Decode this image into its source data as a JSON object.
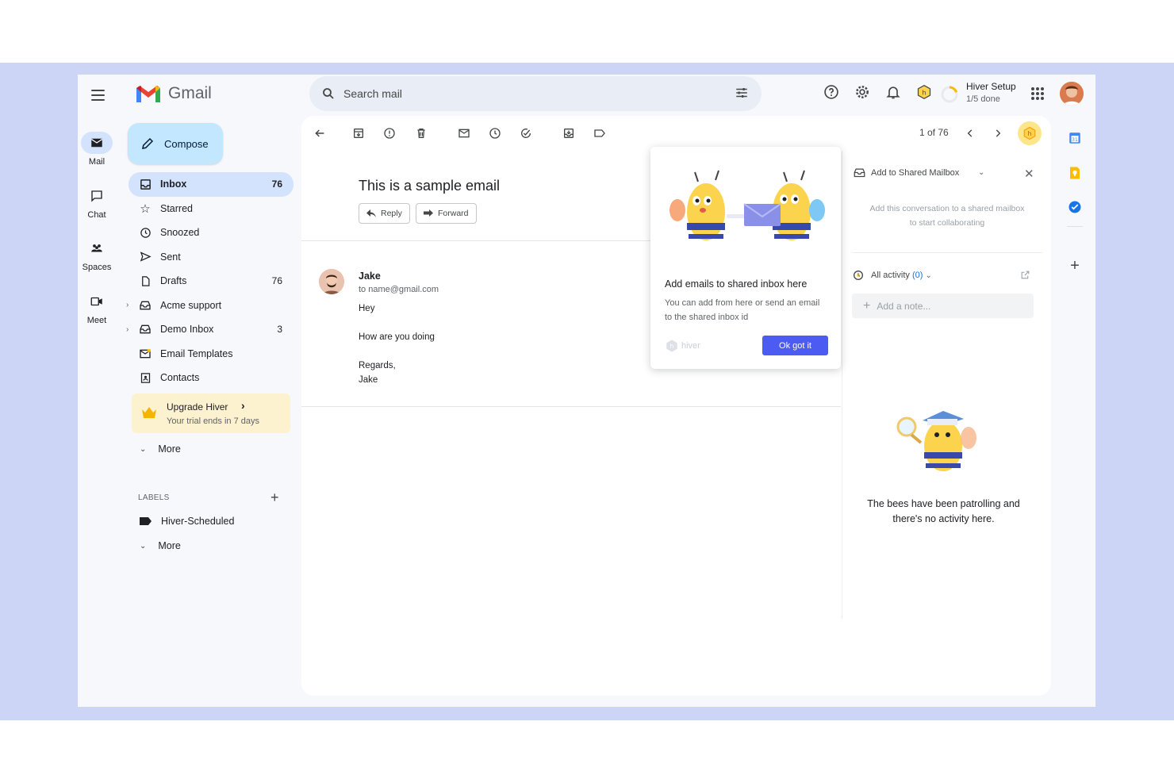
{
  "app": {
    "name": "Gmail"
  },
  "rail": [
    {
      "label": "Mail",
      "icon": "mail-icon"
    },
    {
      "label": "Chat",
      "icon": "chat-icon"
    },
    {
      "label": "Spaces",
      "icon": "spaces-icon"
    },
    {
      "label": "Meet",
      "icon": "meet-icon"
    }
  ],
  "compose": {
    "label": "Compose"
  },
  "nav": [
    {
      "label": "Inbox",
      "count": "76",
      "icon": "inbox-icon"
    },
    {
      "label": "Starred",
      "count": "",
      "icon": "star-icon"
    },
    {
      "label": "Snoozed",
      "count": "",
      "icon": "clock-icon"
    },
    {
      "label": "Sent",
      "count": "",
      "icon": "send-icon"
    },
    {
      "label": "Drafts",
      "count": "76",
      "icon": "draft-icon"
    },
    {
      "label": "Acme support",
      "count": "",
      "icon": "shared-inbox-icon"
    },
    {
      "label": "Demo Inbox",
      "count": "3",
      "icon": "shared-inbox-icon"
    },
    {
      "label": "Email Templates",
      "count": "",
      "icon": "template-icon"
    },
    {
      "label": "Contacts",
      "count": "",
      "icon": "contacts-icon"
    }
  ],
  "upgrade": {
    "title": "Upgrade Hiver",
    "subtitle": "Your trial ends in 7 days"
  },
  "more_label": "More",
  "labels": {
    "header": "LABELS",
    "items": [
      "Hiver-Scheduled"
    ],
    "more": "More"
  },
  "search": {
    "placeholder": "Search mail"
  },
  "setup": {
    "title": "Hiver Setup",
    "progress": "1/5 done"
  },
  "toolbar": {
    "pager": "1 of 76"
  },
  "email": {
    "subject": "This is a sample email",
    "reply": "Reply",
    "forward": "Forward",
    "sender": "Jake",
    "to": "to name@gmail.com",
    "body": [
      "Hey",
      "How are you doing",
      "Regards,",
      "Jake"
    ]
  },
  "popup": {
    "title": "Add emails to shared inbox here",
    "desc": "You can add from here or send an email to the shared inbox id",
    "brand": "hiver",
    "ok": "Ok got it"
  },
  "hiver_panel": {
    "title": "Add to Shared Mailbox",
    "desc": "Add this conversation to a shared mailbox to start collaborating",
    "activity": "All activity",
    "activity_count": "(0)",
    "note_placeholder": "Add a note...",
    "empty": "The bees have been patrolling and there's no activity here."
  },
  "colors": {
    "accent": "#4c5bf1",
    "compose": "#c2e7ff",
    "active_nav": "#d3e3fd",
    "backdrop": "#cdd5f6"
  }
}
